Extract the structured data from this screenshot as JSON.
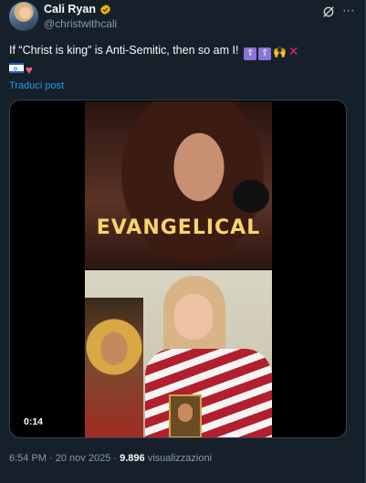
{
  "author": {
    "display_name": "Cali Ryan",
    "handle": "@christwithcali",
    "verified_color": "#f4b400"
  },
  "post": {
    "text": "If “Christ is king” is Anti-Semitic, then so am I!",
    "emojis_line1": [
      "orthodox-cross",
      "orthodox-cross",
      "raising-hands",
      "cross-mark"
    ],
    "emojis_line2": [
      "israel-flag",
      "heart"
    ],
    "translate_label": "Traduci post"
  },
  "media": {
    "caption": "EVANGELICAL",
    "duration": "0:14"
  },
  "meta": {
    "time": "6:54 PM",
    "separator": "·",
    "date": "20 nov 2025",
    "views_count": "9.896",
    "views_label": "visualizzazioni"
  },
  "colors": {
    "background": "#15202b",
    "link": "#1d9bf0",
    "secondary_text": "#8b98a5",
    "caption_yellow": "#f6d66a"
  }
}
